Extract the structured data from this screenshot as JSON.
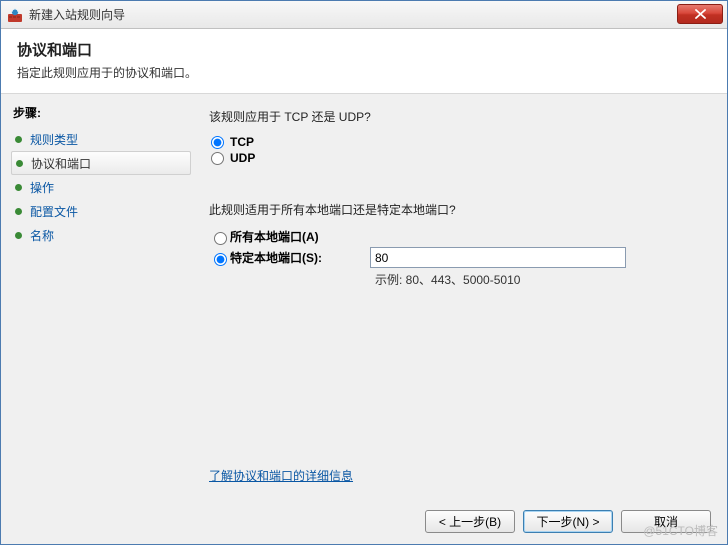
{
  "window": {
    "title": "新建入站规则向导"
  },
  "header": {
    "title": "协议和端口",
    "subtitle": "指定此规则应用于的协议和端口。"
  },
  "sidebar": {
    "steps_label": "步骤:",
    "items": [
      {
        "label": "规则类型",
        "is_link": true,
        "is_current": false
      },
      {
        "label": "协议和端口",
        "is_link": false,
        "is_current": true
      },
      {
        "label": "操作",
        "is_link": true,
        "is_current": false
      },
      {
        "label": "配置文件",
        "is_link": true,
        "is_current": false
      },
      {
        "label": "名称",
        "is_link": true,
        "is_current": false
      }
    ]
  },
  "content": {
    "protocol_question": "该规则应用于 TCP 还是 UDP?",
    "tcp_label": "TCP",
    "udp_label": "UDP",
    "protocol_selected": "tcp",
    "port_question": "此规则适用于所有本地端口还是特定本地端口?",
    "all_ports_label": "所有本地端口(A)",
    "specific_ports_label": "特定本地端口(S):",
    "port_mode_selected": "specific",
    "port_value": "80",
    "port_example": "示例: 80、443、5000-5010",
    "learn_more": "了解协议和端口的详细信息"
  },
  "footer": {
    "back": "< 上一步(B)",
    "next": "下一步(N) >",
    "cancel": "取消"
  },
  "watermark": "@51CTO博客"
}
